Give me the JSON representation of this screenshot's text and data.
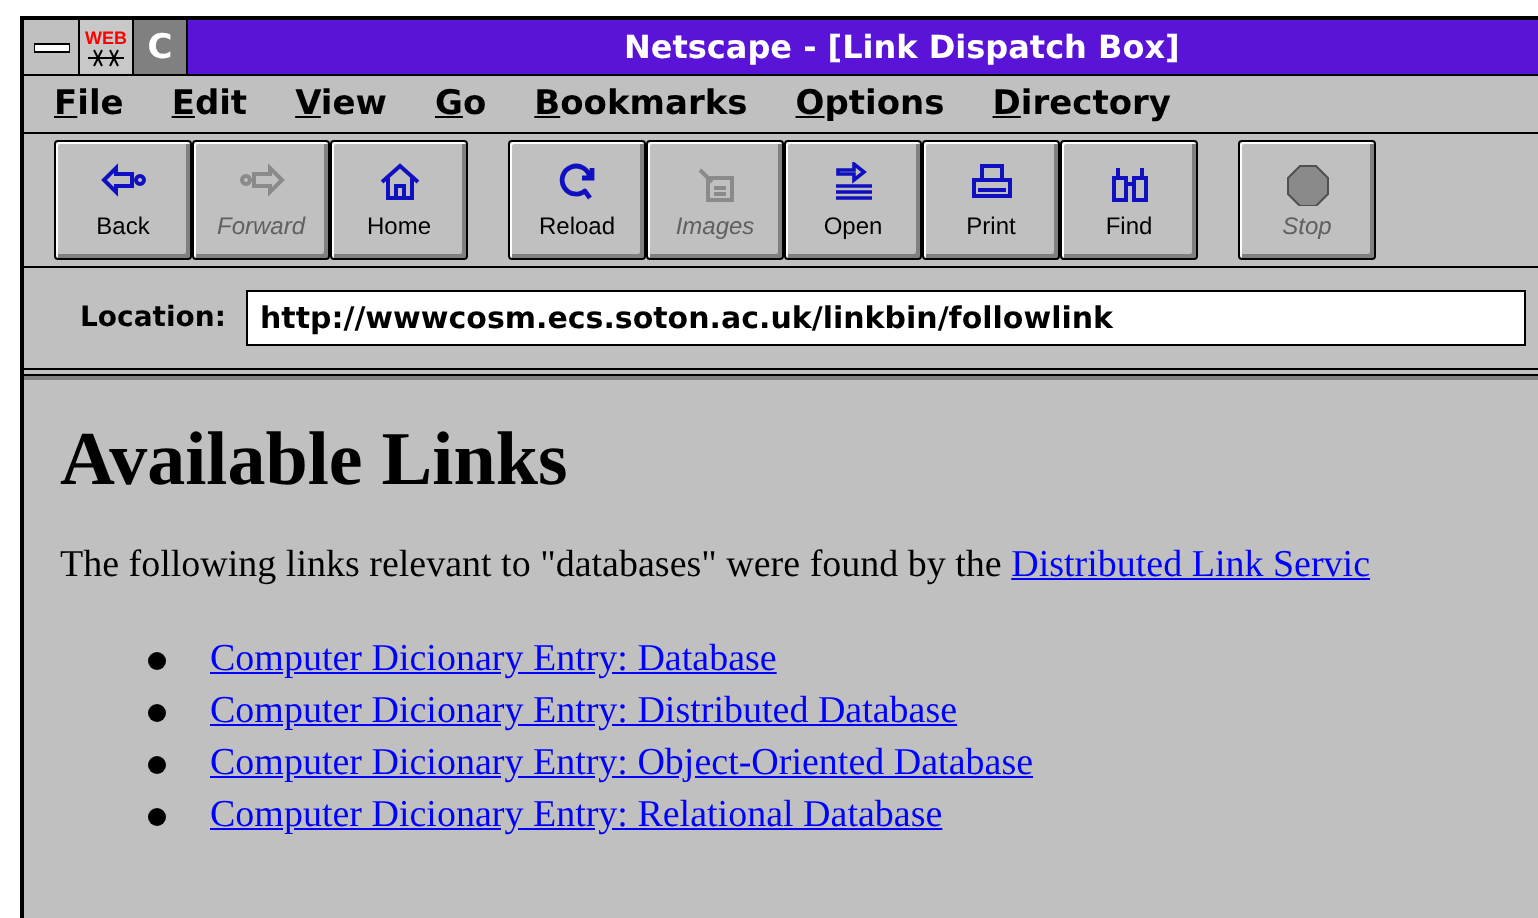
{
  "window": {
    "title": "Netscape - [Link Dispatch Box]",
    "logo_text": "WEB",
    "restore_label": "C"
  },
  "menu": [
    {
      "label": "File"
    },
    {
      "label": "Edit"
    },
    {
      "label": "View"
    },
    {
      "label": "Go"
    },
    {
      "label": "Bookmarks"
    },
    {
      "label": "Options"
    },
    {
      "label": "Directory"
    }
  ],
  "toolbar": [
    [
      {
        "kind": "back",
        "label": "Back",
        "disabled": false
      },
      {
        "kind": "forward",
        "label": "Forward",
        "disabled": true
      },
      {
        "kind": "home",
        "label": "Home",
        "disabled": false
      }
    ],
    [
      {
        "kind": "reload",
        "label": "Reload",
        "disabled": false
      },
      {
        "kind": "images",
        "label": "Images",
        "disabled": true
      },
      {
        "kind": "open",
        "label": "Open",
        "disabled": false
      },
      {
        "kind": "print",
        "label": "Print",
        "disabled": false
      },
      {
        "kind": "find",
        "label": "Find",
        "disabled": false
      }
    ],
    [
      {
        "kind": "stop",
        "label": "Stop",
        "disabled": true
      }
    ]
  ],
  "location": {
    "label": "Location:",
    "value": "http://wwwcosm.ecs.soton.ac.uk/linkbin/followlink"
  },
  "page": {
    "heading": "Available Links",
    "intro": "The following links relevant to \"databases\" were found by the",
    "intro_link": "Distributed Link Servic",
    "links": [
      "Computer Dicionary Entry: Database",
      "Computer Dicionary Entry: Distributed Database",
      "Computer Dicionary Entry: Object-Oriented Database",
      "Computer Dicionary Entry: Relational Database"
    ]
  }
}
